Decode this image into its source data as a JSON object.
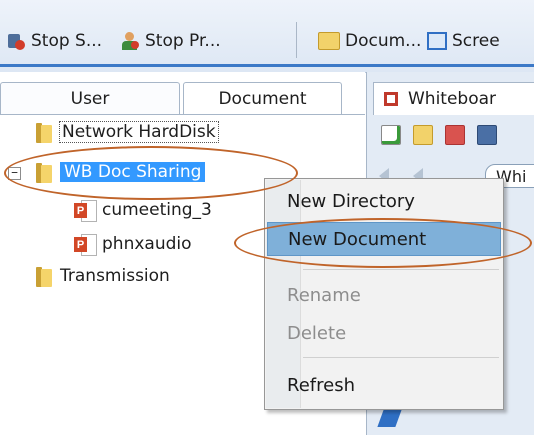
{
  "toolbar": {
    "items": [
      {
        "label": "Stop S...",
        "icon": "stop-sharing-icon"
      },
      {
        "label": "Stop Pr...",
        "icon": "stop-presenting-icon"
      },
      {
        "label": "Docum...",
        "icon": "folder-icon"
      },
      {
        "label": "Scree",
        "icon": "screen-icon"
      }
    ]
  },
  "left_panel": {
    "tabs": [
      {
        "label": "User"
      },
      {
        "label": "Document"
      }
    ],
    "tree": [
      {
        "label": "Network HardDisk",
        "icon": "folder-icon"
      },
      {
        "label": "WB Doc Sharing",
        "icon": "folder-icon",
        "selected": true,
        "expanded": true
      },
      {
        "label": "cumeeting_3",
        "icon": "powerpoint-file-icon"
      },
      {
        "label": "phnxaudio",
        "icon": "powerpoint-file-icon"
      },
      {
        "label": "Transmission",
        "icon": "folder-icon"
      }
    ],
    "expander_symbol": "−"
  },
  "right_panel": {
    "tab_label": "Whiteboar",
    "page_tab_label": "Whi"
  },
  "context_menu": {
    "items": [
      {
        "label": "New Directory",
        "enabled": true
      },
      {
        "label": "New Document",
        "enabled": true,
        "highlighted": true
      },
      {
        "label": "Rename",
        "enabled": false
      },
      {
        "label": "Delete",
        "enabled": false
      },
      {
        "label": "Refresh",
        "enabled": true
      }
    ]
  },
  "colors": {
    "selection": "#3399ff",
    "annotation": "#c0642a",
    "menu_highlight": "#7fb0d9"
  }
}
